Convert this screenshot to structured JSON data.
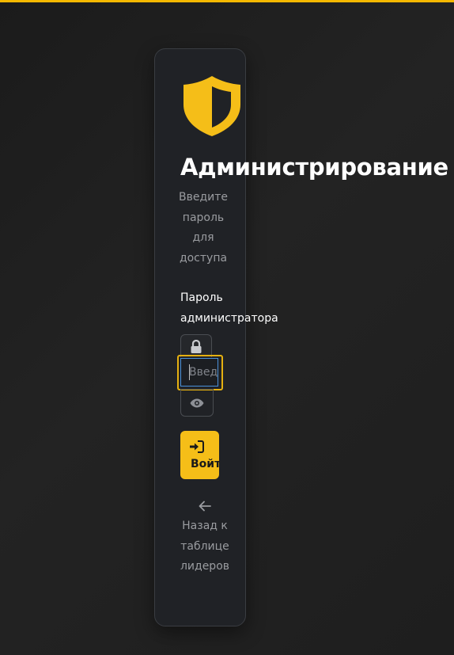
{
  "theme": {
    "accent": "#f5be18",
    "background": "#1f1f1f",
    "card_background": "#202226",
    "input_focus_border": "#4a90d9"
  },
  "header": {
    "icon": "shield-icon",
    "title": "Администрирование",
    "subtitle": "Введите пароль для доступа"
  },
  "form": {
    "password_label": "Пароль администратора",
    "lock_icon": "lock-icon",
    "password_placeholder": "Введите пароль",
    "password_value": "",
    "toggle_visibility_icon": "eye-icon",
    "submit_icon": "sign-in-icon",
    "submit_label": "Войти"
  },
  "footer": {
    "back_icon": "arrow-left-icon",
    "back_label": "Назад к таблице лидеров"
  }
}
